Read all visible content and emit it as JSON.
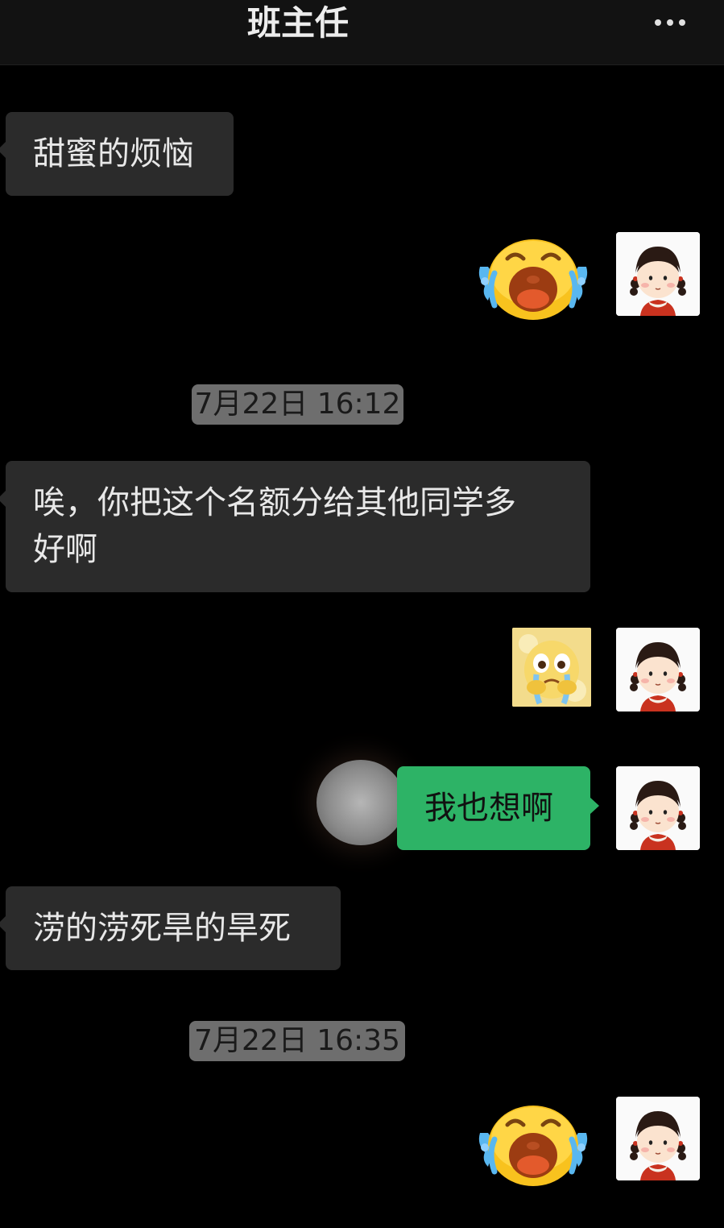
{
  "header": {
    "title": "班主任",
    "more_icon": "more-dots-icon"
  },
  "messages": [
    {
      "side": "in",
      "type": "text",
      "text": "甜蜜的烦恼"
    },
    {
      "side": "out",
      "type": "sticker",
      "sticker": "crying-face-emoji-icon"
    },
    {
      "type": "timestamp",
      "text": "7月22日 16:12"
    },
    {
      "side": "in",
      "type": "text",
      "lines": [
        "唉，你把这个名额分给其他同学多",
        "好啊"
      ]
    },
    {
      "side": "out",
      "type": "sticker",
      "sticker": "crying-cartoon-sticker-icon"
    },
    {
      "side": "out",
      "type": "text",
      "text": "我也想啊"
    },
    {
      "side": "in",
      "type": "text",
      "text": "涝的涝死旱的旱死"
    },
    {
      "type": "timestamp",
      "text": "7月22日 16:35"
    },
    {
      "side": "out",
      "type": "sticker",
      "sticker": "crying-face-emoji-icon"
    }
  ],
  "avatar_icon": "girl-avatar-icon",
  "colors": {
    "background": "#000000",
    "incoming_bubble": "#2b2b2b",
    "outgoing_bubble": "#2db366",
    "timestamp_pill": "#6e6e6e"
  }
}
